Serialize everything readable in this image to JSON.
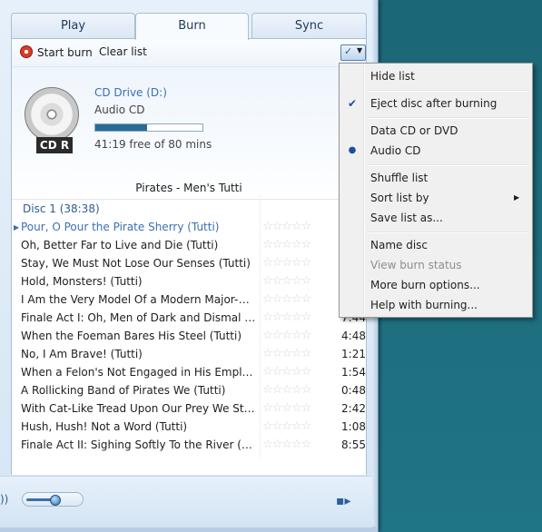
{
  "tabs": [
    {
      "label": "Play"
    },
    {
      "label": "Burn"
    },
    {
      "label": "Sync"
    }
  ],
  "toolbar": {
    "start_burn": "Start burn",
    "clear_list": "Clear list"
  },
  "disc": {
    "drive_name": "CD Drive (D:)",
    "disc_type": "Audio CD",
    "badge": "CD R",
    "free_text": "41:19 free of 80 mins",
    "used_fraction": 0.48
  },
  "list": {
    "title": "Pirates - Men's Tutti",
    "group": "Disc 1 (38:38)",
    "rows": [
      {
        "title": "Pour, O Pour the Pirate Sherry (Tutti)",
        "length": ""
      },
      {
        "title": "Oh, Better Far to Live and Die (Tutti)",
        "length": ""
      },
      {
        "title": "Stay, We Must Not Lose Our Senses (Tutti)",
        "length": ""
      },
      {
        "title": "Hold, Monsters! (Tutti)",
        "length": ""
      },
      {
        "title": "I Am the Very Model Of a Modern Major-Gener...",
        "length": ""
      },
      {
        "title": "Finale Act I: Oh, Men of Dark and Dismal Fate (T...",
        "length": "7:44"
      },
      {
        "title": "When the Foeman Bares His Steel (Tutti)",
        "length": "4:48"
      },
      {
        "title": "No, I Am Brave! (Tutti)",
        "length": "1:21"
      },
      {
        "title": "When a Felon's Not Engaged in His Employmen...",
        "length": "1:54"
      },
      {
        "title": "A Rollicking Band of Pirates We (Tutti)",
        "length": "0:48"
      },
      {
        "title": "With Cat-Like Tread Upon Our Prey We Steal (T...",
        "length": "2:42"
      },
      {
        "title": "Hush, Hush! Not a Word (Tutti)",
        "length": "1:08"
      },
      {
        "title": "Finale Act II: Sighing Softly To the River (Tutti)",
        "length": "8:55"
      }
    ]
  },
  "menu": {
    "hide_list": "Hide list",
    "eject_after": "Eject disc after burning",
    "data_cd": "Data CD or DVD",
    "audio_cd": "Audio CD",
    "shuffle": "Shuffle list",
    "sort_by": "Sort list by",
    "save_as": "Save list as...",
    "name_disc": "Name disc",
    "view_status": "View burn status",
    "more_options": "More burn options...",
    "help": "Help with burning..."
  },
  "icons": {
    "burn": "burn-disc-icon",
    "list_options": "list-options-icon",
    "cd": "cd-disc-icon",
    "volume": "speaker-icon",
    "switch": "switch-to-now-playing-icon"
  },
  "volume_level": 0.5
}
